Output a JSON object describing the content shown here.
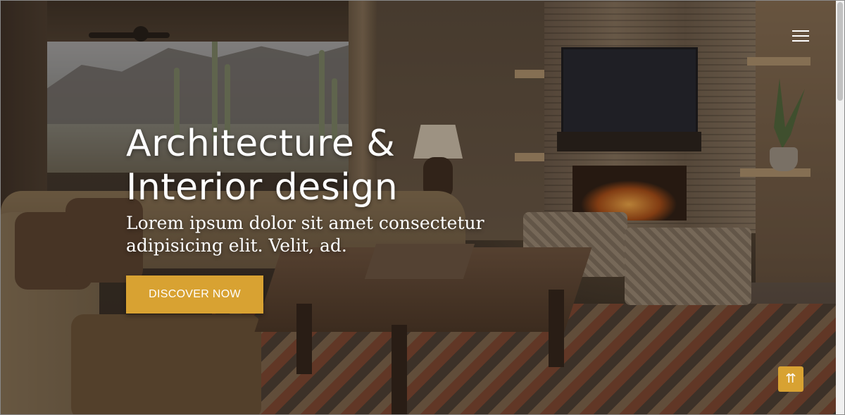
{
  "hero": {
    "title_line1": "Architecture &",
    "title_line2": "Interior design",
    "subtitle": "Lorem ipsum dolor sit amet consectetur adipisicing elit. Velit, ad.",
    "cta_label": "DISCOVER NOW"
  },
  "nav": {
    "menu_icon": "hamburger-menu-icon"
  },
  "back_to_top": {
    "icon": "double-arrow-up-icon",
    "glyph": "⇈"
  },
  "colors": {
    "accent": "#d8a232",
    "text": "#ffffff",
    "overlay": "#1e160e"
  }
}
